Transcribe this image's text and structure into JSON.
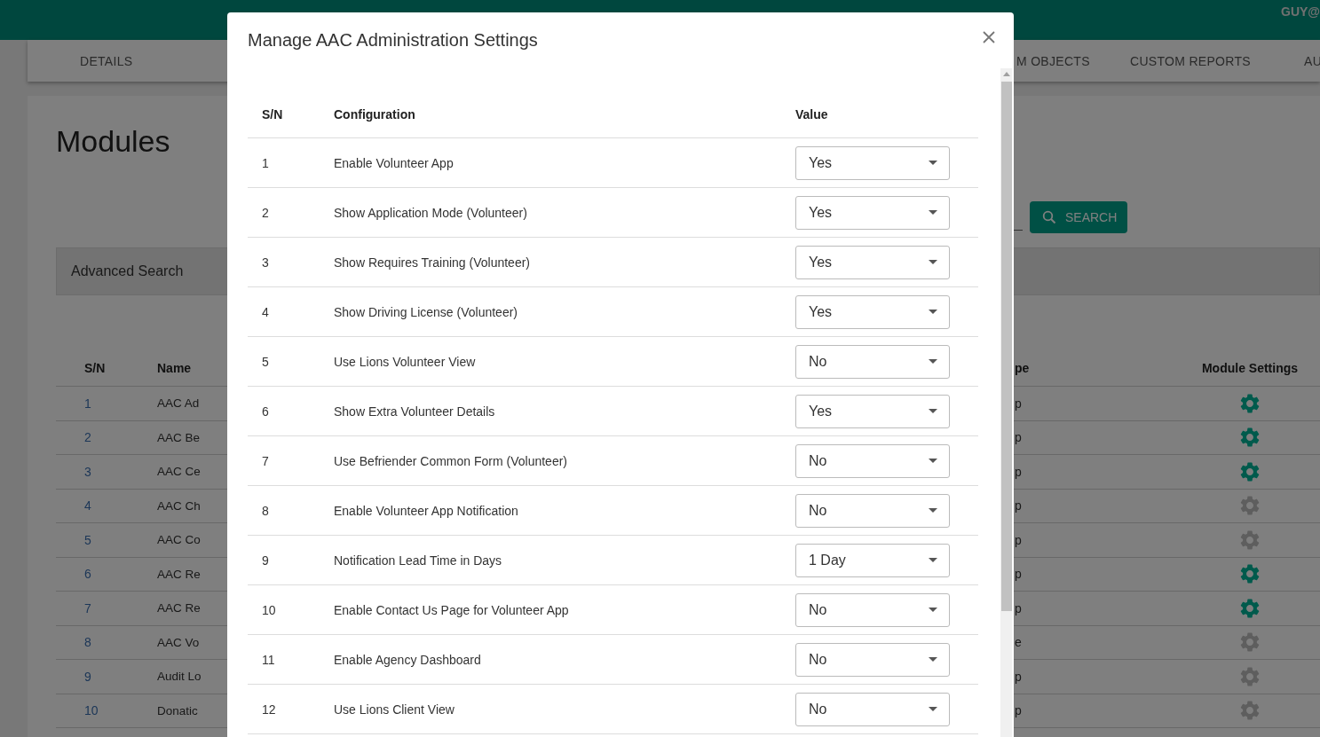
{
  "top_bar": {
    "user": "GUY@"
  },
  "tabs": [
    {
      "label": "DETAILS"
    },
    {
      "label": "M OBJECTS"
    },
    {
      "label": "CUSTOM REPORTS"
    },
    {
      "label": "AU"
    }
  ],
  "page": {
    "title": "Modules",
    "search_button": "SEARCH",
    "advanced_search": "Advanced Search"
  },
  "modules": {
    "columns": [
      "S/N",
      "Name",
      "pe",
      "Module Settings"
    ],
    "rows": [
      {
        "sn": "1",
        "name": "AAC Ad",
        "type": "p",
        "enabled": true
      },
      {
        "sn": "2",
        "name": "AAC Be",
        "type": "p",
        "enabled": true
      },
      {
        "sn": "3",
        "name": "AAC Ce",
        "type": "p",
        "enabled": true
      },
      {
        "sn": "4",
        "name": "AAC Ch",
        "type": "p",
        "enabled": false
      },
      {
        "sn": "5",
        "name": "AAC Co",
        "type": "p",
        "enabled": false
      },
      {
        "sn": "6",
        "name": "AAC Re",
        "type": "p",
        "enabled": true
      },
      {
        "sn": "7",
        "name": "AAC Re",
        "type": "p",
        "enabled": true
      },
      {
        "sn": "8",
        "name": "AAC Vo",
        "type": "e",
        "enabled": false
      },
      {
        "sn": "9",
        "name": "Audit Lo",
        "type": "p",
        "enabled": false
      },
      {
        "sn": "10",
        "name": "Donatic",
        "type": "p",
        "enabled": false
      }
    ]
  },
  "dialog": {
    "title": "Manage AAC Administration Settings",
    "columns": [
      "S/N",
      "Configuration",
      "Value"
    ],
    "rows": [
      {
        "sn": "1",
        "configuration": "Enable Volunteer App",
        "value": "Yes"
      },
      {
        "sn": "2",
        "configuration": "Show Application Mode (Volunteer)",
        "value": "Yes"
      },
      {
        "sn": "3",
        "configuration": "Show Requires Training (Volunteer)",
        "value": "Yes"
      },
      {
        "sn": "4",
        "configuration": "Show Driving License (Volunteer)",
        "value": "Yes"
      },
      {
        "sn": "5",
        "configuration": "Use Lions Volunteer View",
        "value": "No"
      },
      {
        "sn": "6",
        "configuration": "Show Extra Volunteer Details",
        "value": "Yes"
      },
      {
        "sn": "7",
        "configuration": "Use Befriender Common Form (Volunteer)",
        "value": "No"
      },
      {
        "sn": "8",
        "configuration": "Enable Volunteer App Notification",
        "value": "No"
      },
      {
        "sn": "9",
        "configuration": "Notification Lead Time in Days",
        "value": "1 Day"
      },
      {
        "sn": "10",
        "configuration": "Enable Contact Us Page for Volunteer App",
        "value": "No"
      },
      {
        "sn": "11",
        "configuration": "Enable Agency Dashboard",
        "value": "No"
      },
      {
        "sn": "12",
        "configuration": "Use Lions Client View",
        "value": "No"
      }
    ]
  }
}
